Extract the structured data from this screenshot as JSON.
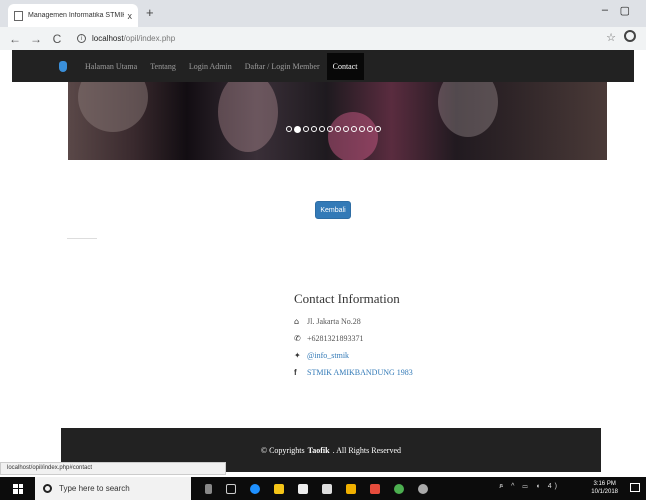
{
  "browser": {
    "tab_title": "Managemen Informatika STMIK :",
    "tab_close": "x",
    "new_tab": "+",
    "url_host": "localhost",
    "url_path": "/opil/index.php",
    "back": "←",
    "forward": "→",
    "reload": "C",
    "info": "i",
    "star": "☆",
    "minimize": "–",
    "restore": "▢"
  },
  "navbar": {
    "items": [
      {
        "label": "Halaman Utama"
      },
      {
        "label": "Tentang"
      },
      {
        "label": "Login Admin"
      },
      {
        "label": "Daftar / Login Member"
      },
      {
        "label": "Contact",
        "active": true
      }
    ]
  },
  "carousel": {
    "indicator_count": 12,
    "active_index": 1
  },
  "main": {
    "back_button": "Kembali"
  },
  "contact": {
    "heading": "Contact Information",
    "address": "Jl. Jakarta No.28",
    "phone": "+6281321893371",
    "twitter": "@info_stmik",
    "facebook": "STMIK AMIKBANDUNG 1983",
    "icons": {
      "address": "home-icon",
      "phone": "phone-icon",
      "twitter": "twitter-icon",
      "facebook": "facebook-icon"
    }
  },
  "footer": {
    "prefix": "© Copyrights",
    "name": "Taofik",
    "suffix": ". All Rights Reserved"
  },
  "statusbar": {
    "url": "localhost/opil/index.php#contact"
  },
  "taskbar": {
    "search_placeholder": "Type here to search",
    "time": "3:16 PM",
    "date": "10/1/2018",
    "tray": "ጾ ^ ▭ ◖ 4)"
  },
  "colors": {
    "navbar_bg": "#222222",
    "link": "#337ab7",
    "button": "#337ab7",
    "footer_bg": "#222222"
  }
}
